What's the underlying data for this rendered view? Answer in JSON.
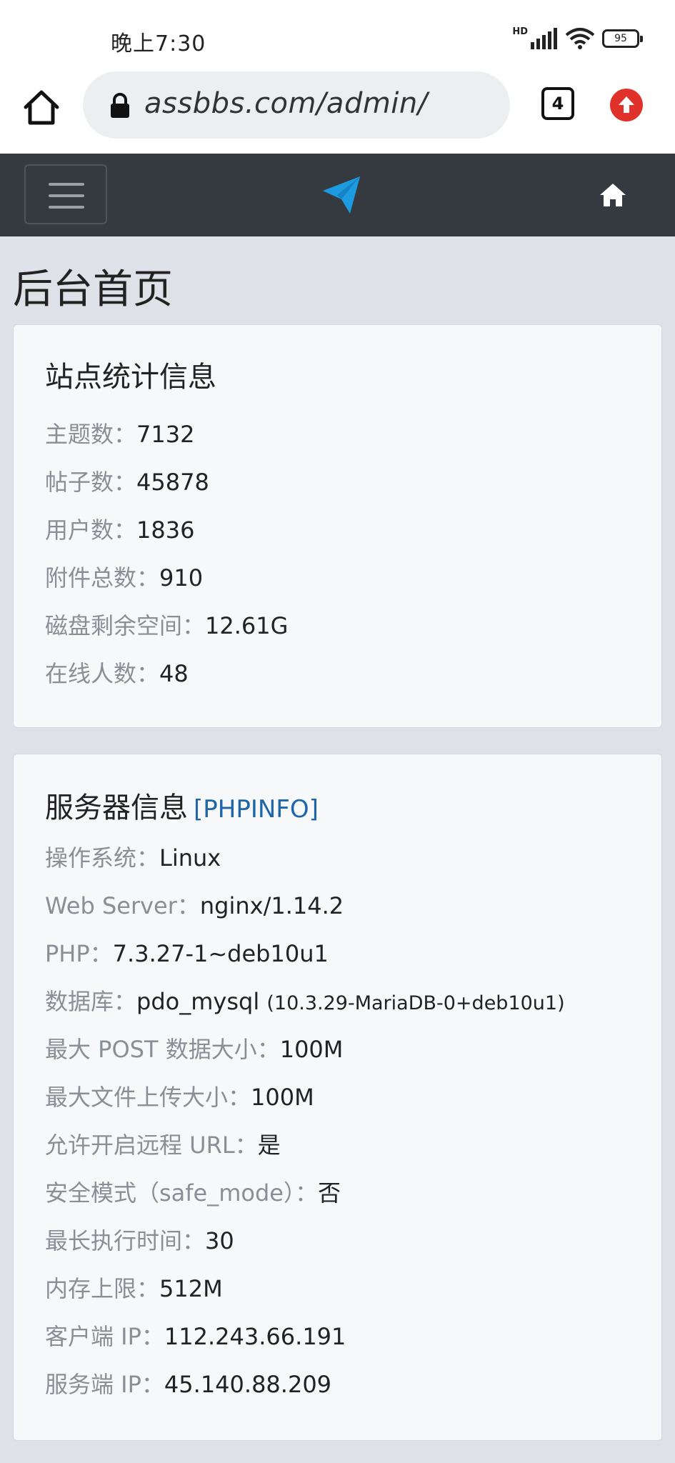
{
  "status_bar": {
    "time": "晚上7:30",
    "battery": "95",
    "network_label": "HD"
  },
  "browser": {
    "url": "assbbs.com/admin/",
    "tab_count": "4"
  },
  "page": {
    "title": "后台首页"
  },
  "site_stats": {
    "heading": "站点统计信息",
    "rows": [
      {
        "label": "主题数：",
        "value": "7132"
      },
      {
        "label": "帖子数：",
        "value": "45878"
      },
      {
        "label": "用户数：",
        "value": "1836"
      },
      {
        "label": "附件总数：",
        "value": "910"
      },
      {
        "label": "磁盘剩余空间：",
        "value": "12.61G"
      },
      {
        "label": "在线人数：",
        "value": "48"
      }
    ]
  },
  "server_info": {
    "heading": "服务器信息",
    "phpinfo_link": "[PHPINFO]",
    "rows": [
      {
        "label": "操作系统：",
        "value": "Linux"
      },
      {
        "label": "Web Server：",
        "value": "nginx/1.14.2"
      },
      {
        "label": "PHP：",
        "value": "7.3.27-1~deb10u1"
      },
      {
        "label": "数据库：",
        "value": "pdo_mysql",
        "extra": "(10.3.29-MariaDB-0+deb10u1)"
      },
      {
        "label": "最大 POST 数据大小：",
        "value": "100M"
      },
      {
        "label": "最大文件上传大小：",
        "value": "100M"
      },
      {
        "label": "允许开启远程 URL：",
        "value": "是"
      },
      {
        "label": "安全模式（safe_mode）：",
        "value": "否"
      },
      {
        "label": "最长执行时间：",
        "value": "30"
      },
      {
        "label": "内存上限：",
        "value": "512M"
      },
      {
        "label": "客户端 IP：",
        "value": "112.243.66.191"
      },
      {
        "label": "服务端 IP：",
        "value": "45.140.88.209"
      }
    ]
  },
  "colors": {
    "navbar": "#343a40",
    "brand_logo": "#1d9be0",
    "link": "#1e66a8",
    "update_badge": "#e0322b"
  }
}
